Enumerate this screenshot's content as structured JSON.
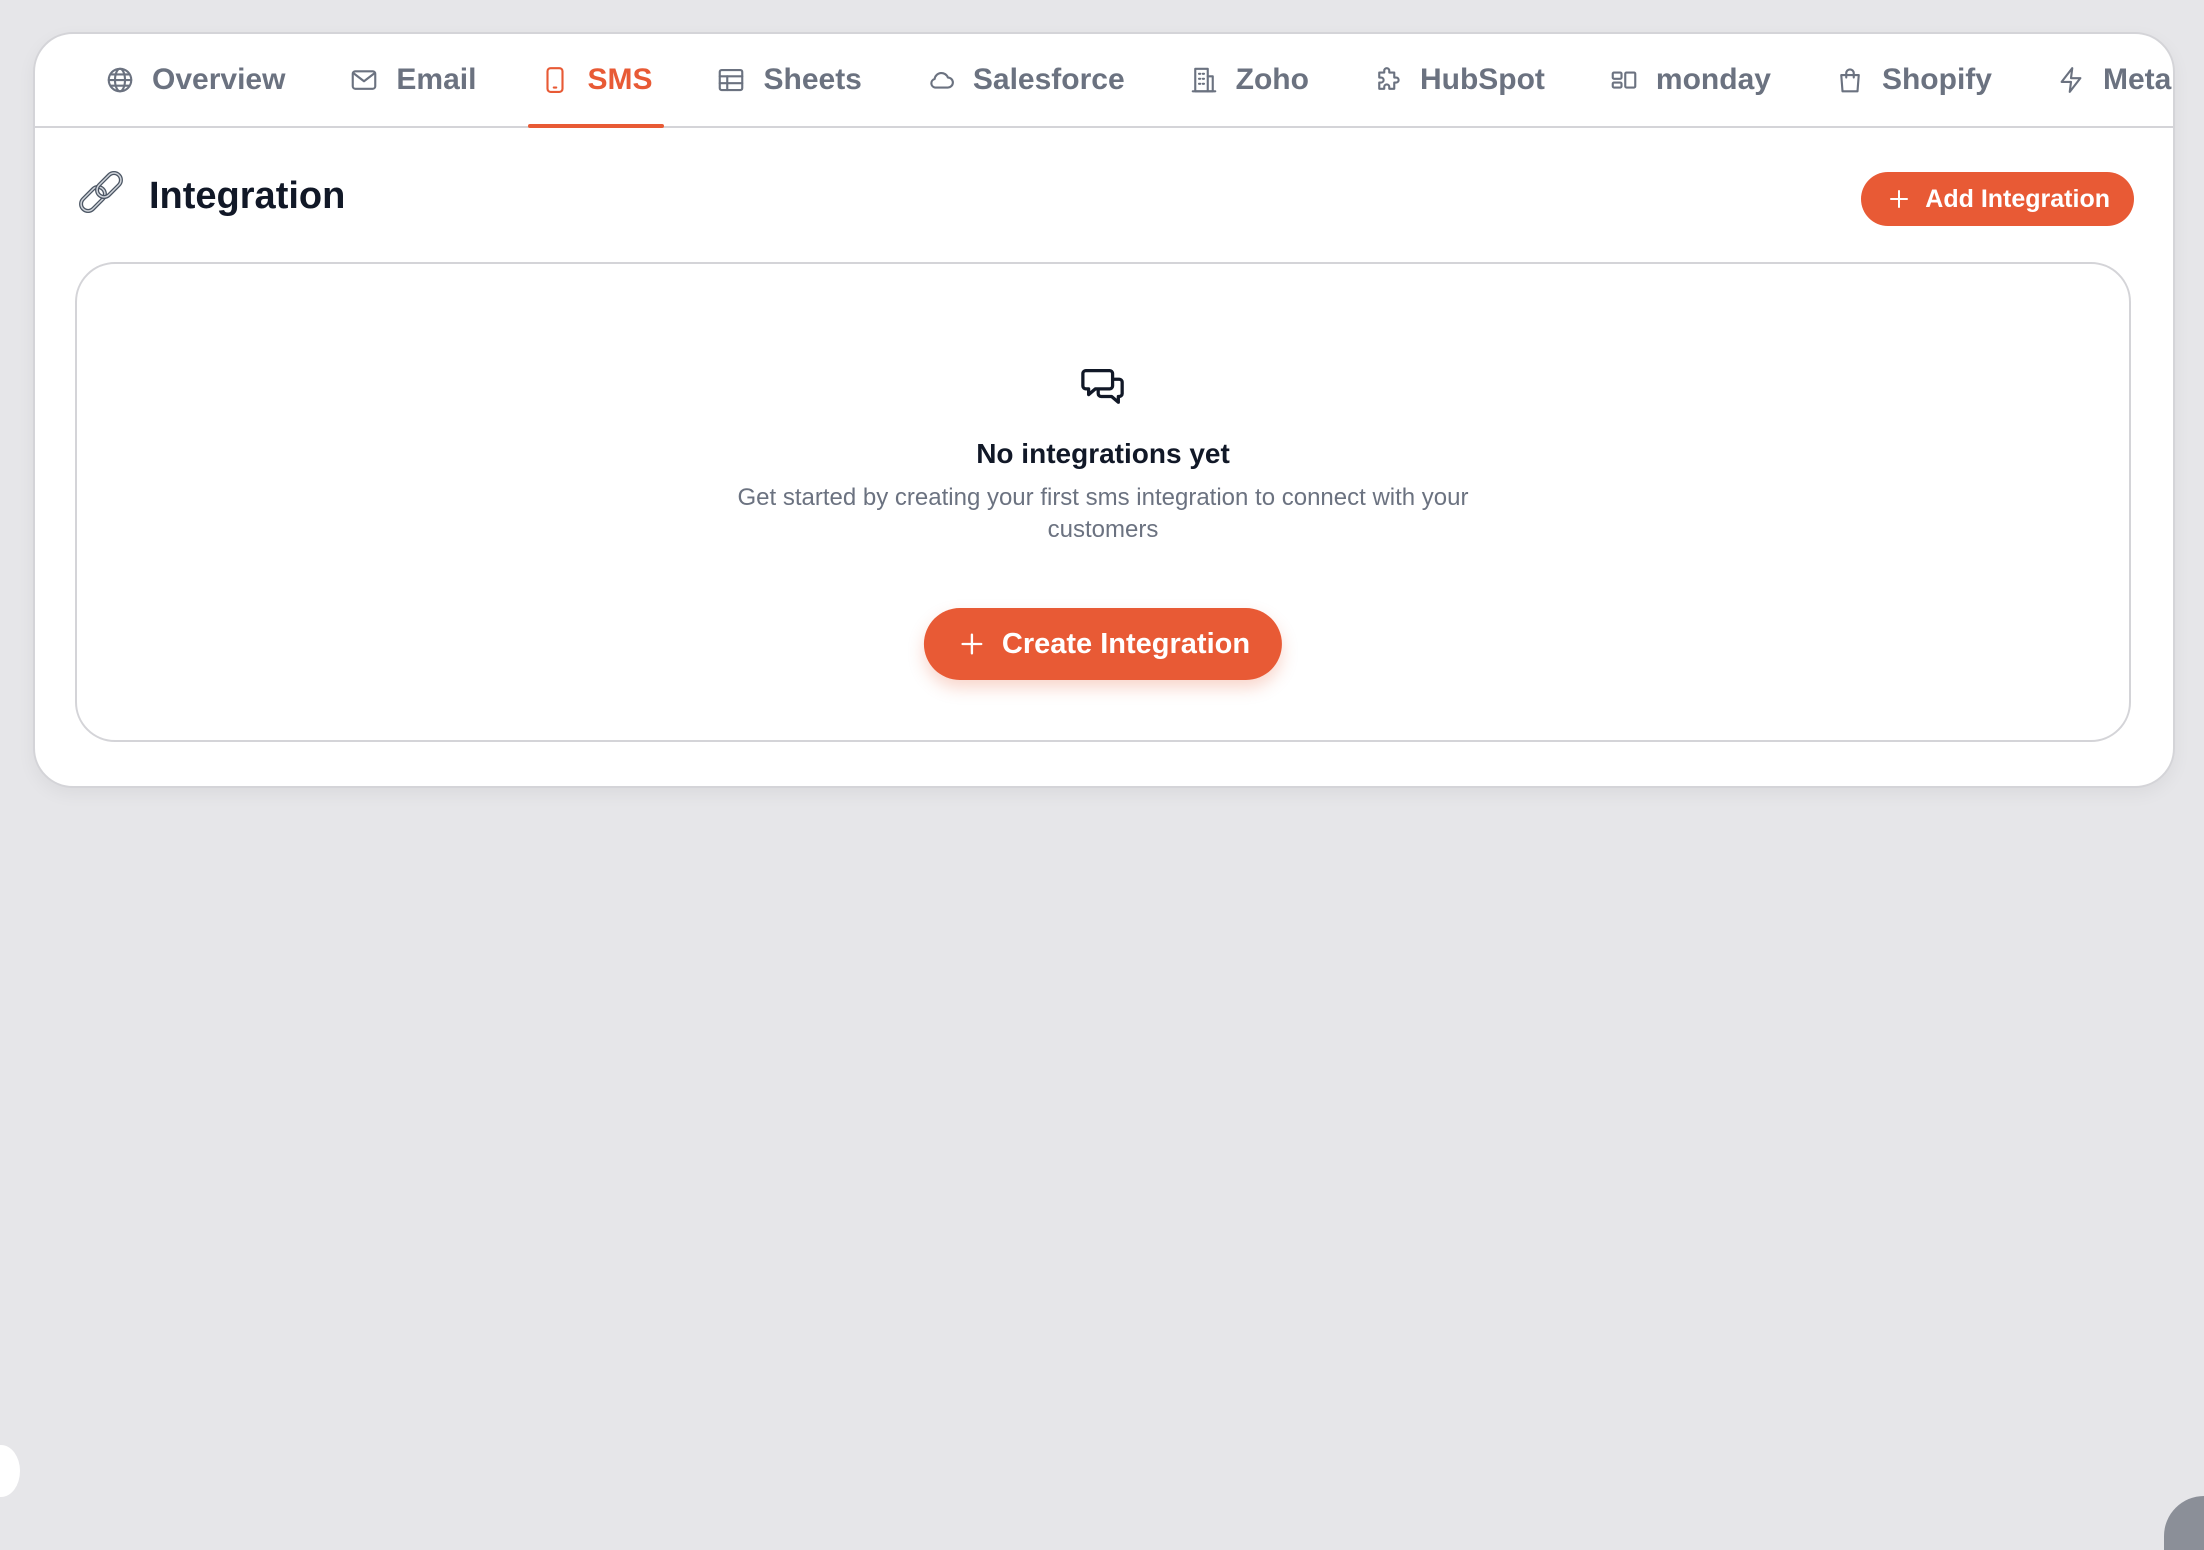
{
  "tabs": [
    {
      "label": "Overview",
      "icon": "globe-icon"
    },
    {
      "label": "Email",
      "icon": "mail-icon"
    },
    {
      "label": "SMS",
      "icon": "smartphone-icon",
      "active": true
    },
    {
      "label": "Sheets",
      "icon": "table-icon"
    },
    {
      "label": "Salesforce",
      "icon": "cloud-icon"
    },
    {
      "label": "Zoho",
      "icon": "building-icon"
    },
    {
      "label": "HubSpot",
      "icon": "puzzle-icon"
    },
    {
      "label": "monday",
      "icon": "board-icon"
    },
    {
      "label": "Shopify",
      "icon": "shopping-bag-icon"
    },
    {
      "label": "Meta Lea",
      "icon": "lightning-icon"
    }
  ],
  "header": {
    "title": "Integration",
    "icon": "link-icon",
    "add_button_label": "Add Integration"
  },
  "empty_state": {
    "icon": "chat-bubbles-icon",
    "title": "No integrations yet",
    "description": "Get started by creating your first sms integration to connect with your customers",
    "button_label": "Create Integration"
  },
  "colors": {
    "accent": "#e85a35",
    "background": "#e6e6e9",
    "text_primary": "#111827",
    "text_muted": "#6b7280",
    "border": "#d4d4d8"
  }
}
